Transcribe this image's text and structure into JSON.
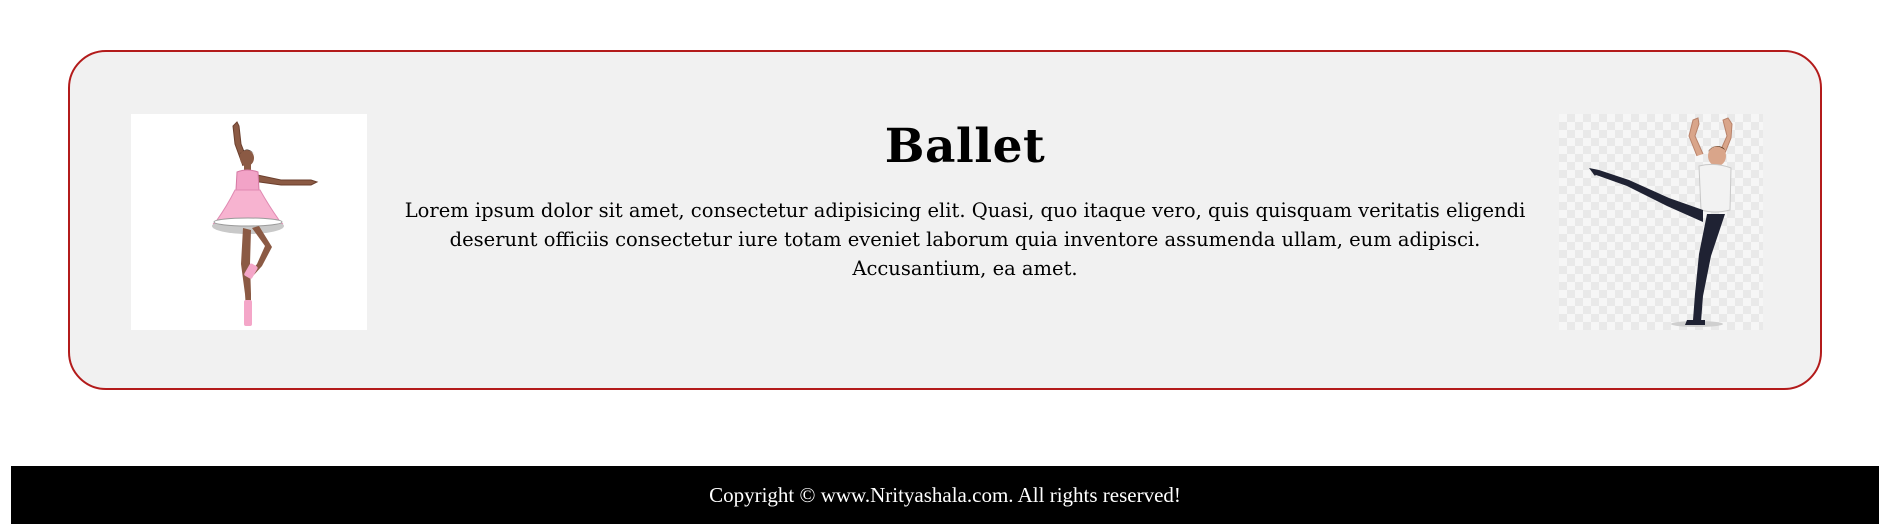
{
  "card": {
    "title": "Ballet",
    "description": "Lorem ipsum dolor sit amet, consectetur adipisicing elit. Quasi, quo itaque vero, quis quisquam veritatis eligendi deserunt officiis consectetur iure totam eveniet laborum quia inventore assumenda ullam, eum adipisci. Accusantium, ea amet.",
    "left_image": {
      "icon": "ballerina-image",
      "content": "ballerina in pink tutu"
    },
    "right_image": {
      "icon": "male-ballet-dancer-image",
      "content": "male ballet dancer in arabesque"
    }
  },
  "footer": {
    "copyright": "Copyright © www.Nrityashala.com. All rights reserved!"
  },
  "colors": {
    "card_background": "#f1f1f1",
    "card_border": "#b31b1b",
    "footer_background": "#000000",
    "footer_text": "#ffffff"
  }
}
